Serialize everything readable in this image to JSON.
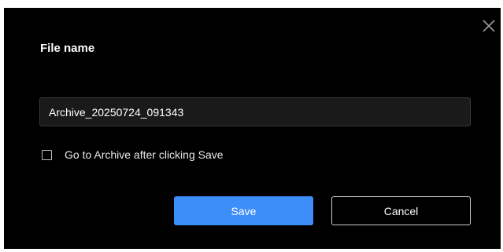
{
  "dialog": {
    "title": "File name",
    "file_name_value": "Archive_20250724_091343",
    "checkbox": {
      "label": "Go to Archive after clicking Save",
      "checked": false
    },
    "buttons": {
      "save_label": "Save",
      "cancel_label": "Cancel"
    },
    "close_icon": "close-icon"
  },
  "colors": {
    "dialog_background": "#000000",
    "primary_button": "#3d8ef8",
    "text": "#ffffff"
  }
}
